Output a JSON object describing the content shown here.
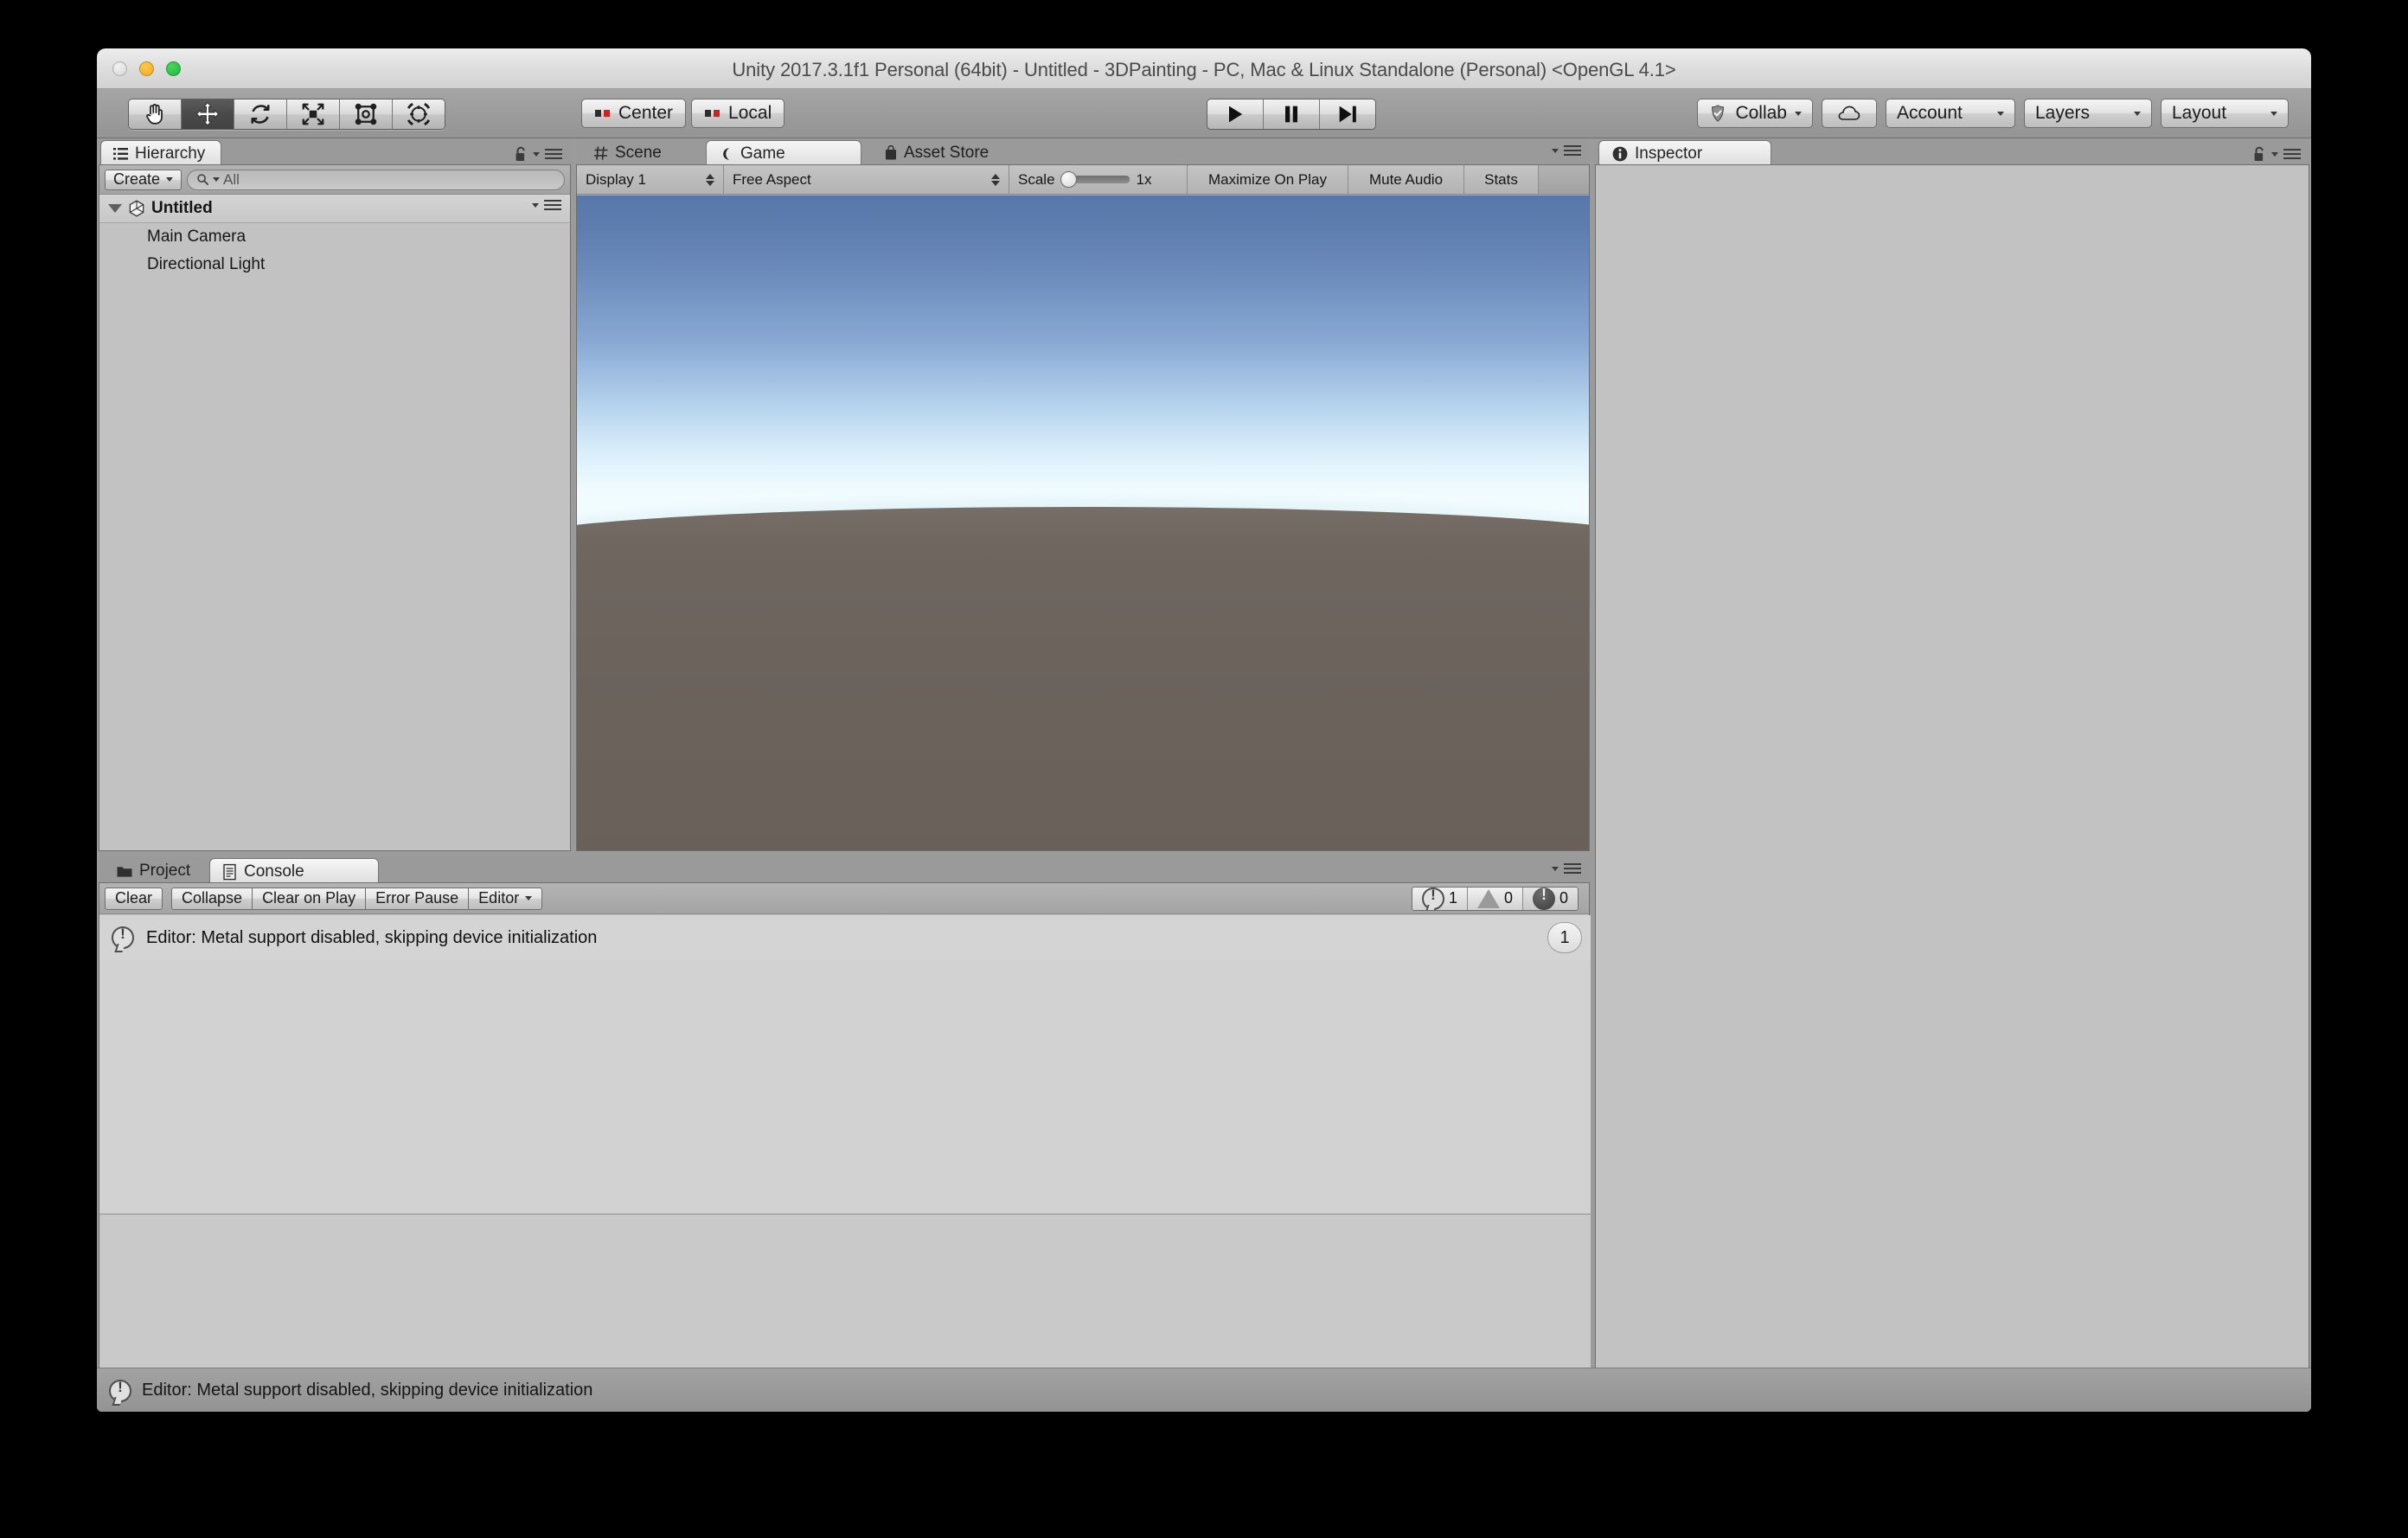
{
  "window": {
    "title": "Unity 2017.3.1f1 Personal (64bit) - Untitled - 3DPainting - PC, Mac & Linux Standalone (Personal) <OpenGL 4.1>"
  },
  "toolbar": {
    "tools": [
      {
        "name": "hand-tool",
        "label": "Hand",
        "active": false
      },
      {
        "name": "move-tool",
        "label": "Move",
        "active": true
      },
      {
        "name": "rotate-tool",
        "label": "Rotate",
        "active": false
      },
      {
        "name": "scale-tool",
        "label": "Scale",
        "active": false
      },
      {
        "name": "rect-tool",
        "label": "Rect Transform",
        "active": false
      },
      {
        "name": "transform-tool",
        "label": "Transform",
        "active": false
      }
    ],
    "pivot_mode": "Center",
    "pivot_rotation": "Local",
    "play": "Play",
    "pause": "Pause",
    "step": "Step",
    "collab": "Collab",
    "cloud": "Cloud",
    "account": "Account",
    "layers": "Layers",
    "layout": "Layout"
  },
  "hierarchy": {
    "tab": "Hierarchy",
    "create_label": "Create",
    "search_placeholder": "All",
    "search_value": "",
    "scene_name": "Untitled",
    "objects": [
      "Main Camera",
      "Directional Light"
    ]
  },
  "sceneview": {
    "tabs": [
      {
        "label": "Scene",
        "active": false
      },
      {
        "label": "Game",
        "active": true
      },
      {
        "label": "Asset Store",
        "active": false
      }
    ],
    "display": "Display 1",
    "aspect": "Free Aspect",
    "scale_label": "Scale",
    "scale_value": "1x",
    "maximize": "Maximize On Play",
    "mute": "Mute Audio",
    "stats": "Stats"
  },
  "inspector": {
    "tab": "Inspector"
  },
  "console": {
    "tabs": [
      {
        "label": "Project",
        "active": false
      },
      {
        "label": "Console",
        "active": true
      }
    ],
    "clear": "Clear",
    "collapse": "Collapse",
    "clear_on_play": "Clear on Play",
    "error_pause": "Error Pause",
    "filter": "Editor",
    "counts": {
      "info": "1",
      "warning": "0",
      "error": "0"
    },
    "messages": [
      {
        "type": "info",
        "text": "Editor: Metal support disabled, skipping device initialization",
        "count": "1"
      }
    ]
  },
  "statusbar": {
    "text": "Editor: Metal support disabled, skipping device initialization"
  },
  "colors": {
    "sky_top": "#5878ab",
    "sky_horizon": "#f2fdff",
    "ground": "#6b635d",
    "chrome": "#9b9b9b",
    "panel": "#c2c2c2"
  }
}
